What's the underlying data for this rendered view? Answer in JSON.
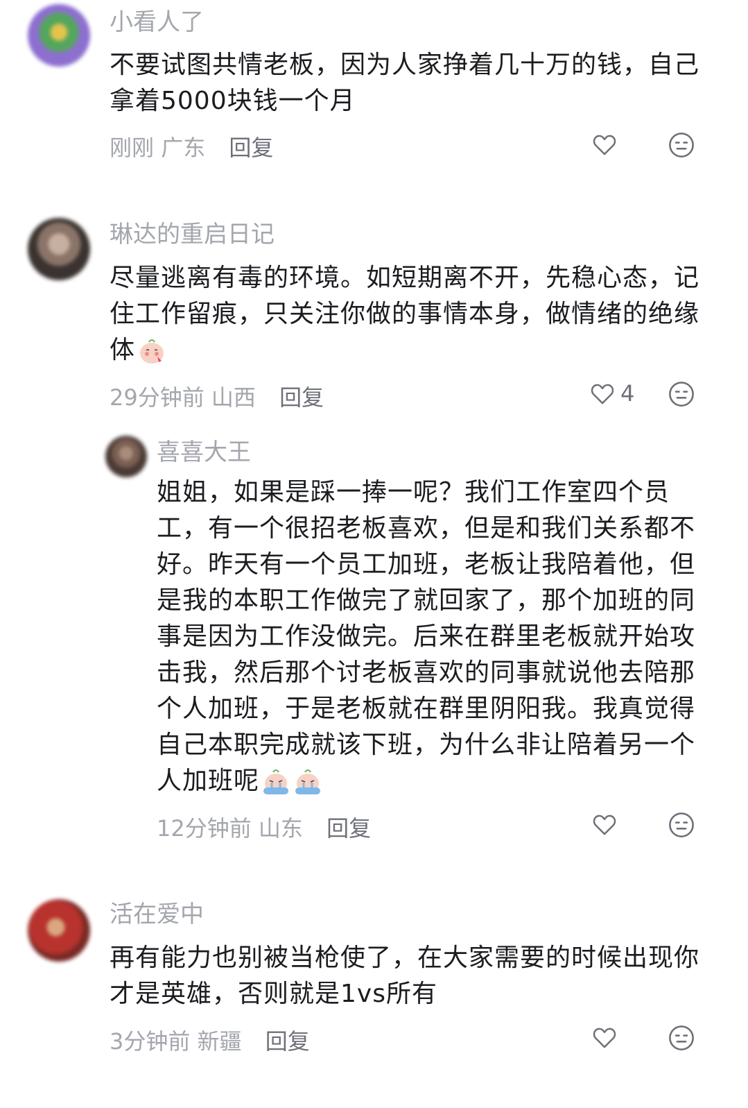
{
  "comments": [
    {
      "username": "小看人了",
      "text": "不要试图共情老板，因为人家挣着几十万的钱，自己拿着5000块钱一个月",
      "time": "刚刚",
      "location": "广东",
      "reply_label": "回复",
      "likes": "",
      "avatar_colors": [
        "#8d6fcf",
        "#54a65d",
        "#e3c44d"
      ]
    },
    {
      "username": "琳达的重启日记",
      "text": "尽量逃离有毒的环境。如短期离不开，先稳心态，记住工作留痕，只关注你做的事情本身，做情绪的绝缘体",
      "time": "29分钟前",
      "location": "山西",
      "reply_label": "回复",
      "likes": "4",
      "emoji": "shy-face-emoji",
      "avatar_colors": [
        "#3a3330",
        "#8a7468",
        "#c8b0a0"
      ]
    },
    {
      "username": "喜喜大王",
      "text": "姐姐，如果是踩一捧一呢？我们工作室四个员工，有一个很招老板喜欢，但是和我们关系都不好。昨天有一个员工加班，老板让我陪着他，但是我的本职工作做完了就回家了，那个加班的同事是因为工作没做完。后来在群里老板就开始攻击我，然后那个讨老板喜欢的同事就说他去陪那个人加班，于是老板就在群里阴阳我。我真觉得自己本职完成就该下班，为什么非让陪着另一个人加班呢",
      "time": "12分钟前",
      "location": "山东",
      "reply_label": "回复",
      "likes": "",
      "emoji": "crying-face-emoji",
      "avatar_colors": [
        "#4a3a34",
        "#7a5f52",
        "#a88c7c"
      ]
    },
    {
      "username": "活在爱中",
      "text": "再有能力也别被当枪使了，在大家需要的时候出现你才是英雄，否则就是1vs所有",
      "time": "3分钟前",
      "location": "新疆",
      "reply_label": "回复",
      "likes": "",
      "avatar_colors": [
        "#b8322e",
        "#7a2a25",
        "#d9a880"
      ]
    }
  ],
  "colors": {
    "name": "#a3a6ad",
    "body": "#1b1c20",
    "meta": "#a3a6ad",
    "icon": "#6e7078"
  }
}
